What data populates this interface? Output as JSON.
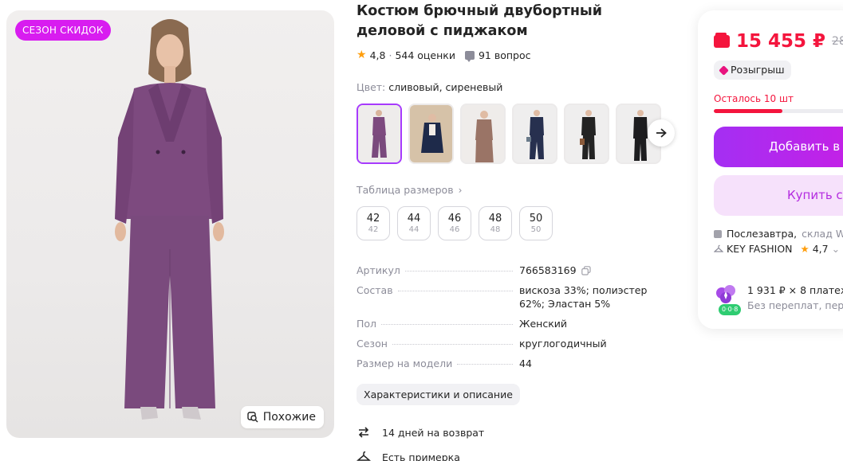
{
  "gallery": {
    "badge": "СЕЗОН СКИДОК",
    "similar_label": "Похожие"
  },
  "product": {
    "title": "Костюм брючный двубортный деловой с пиджаком",
    "rating": "4,8",
    "reviews": "544 оценки",
    "questions": "91 вопрос",
    "color_label": "Цвет:",
    "color_value": "сливовый, сиреневый",
    "size_table_label": "Таблица размеров",
    "sizes": [
      {
        "main": "42",
        "sub": "42"
      },
      {
        "main": "44",
        "sub": "44"
      },
      {
        "main": "46",
        "sub": "46"
      },
      {
        "main": "48",
        "sub": "48"
      },
      {
        "main": "50",
        "sub": "50"
      }
    ],
    "specs": [
      {
        "key": "Артикул",
        "value": "766583169"
      },
      {
        "key": "Состав",
        "value": "вискоза 33%; полиэстер 62%; Эластан 5%"
      },
      {
        "key": "Пол",
        "value": "Женский"
      },
      {
        "key": "Сезон",
        "value": "круглогодичный"
      },
      {
        "key": "Размер на модели",
        "value": "44"
      }
    ],
    "chars_button": "Характеристики и описание",
    "return_text": "14 дней на возврат",
    "fitting_text": "Есть примерка"
  },
  "card": {
    "price": "15 455 ₽",
    "old_price": "28 2",
    "raffle": "Розыгрыш",
    "stock_text": "Осталось 10 шт",
    "stock_fraction": 0.48,
    "add_to_cart": "Добавить в",
    "buy_now": "Купить с",
    "delivery_date": "Послезавтра,",
    "delivery_place": "склад WB",
    "seller_name": "KEY FASHION",
    "seller_rating": "4,7",
    "installment": "1 931 ₽ × 8 платеж",
    "installment_note": "Без переплат, пер",
    "installment_badge": "0·0·8"
  },
  "colors": {
    "accent": "#a73afd",
    "price": "#f4153d",
    "badge": "#d81cf0",
    "suit": "#7d4a7f"
  }
}
